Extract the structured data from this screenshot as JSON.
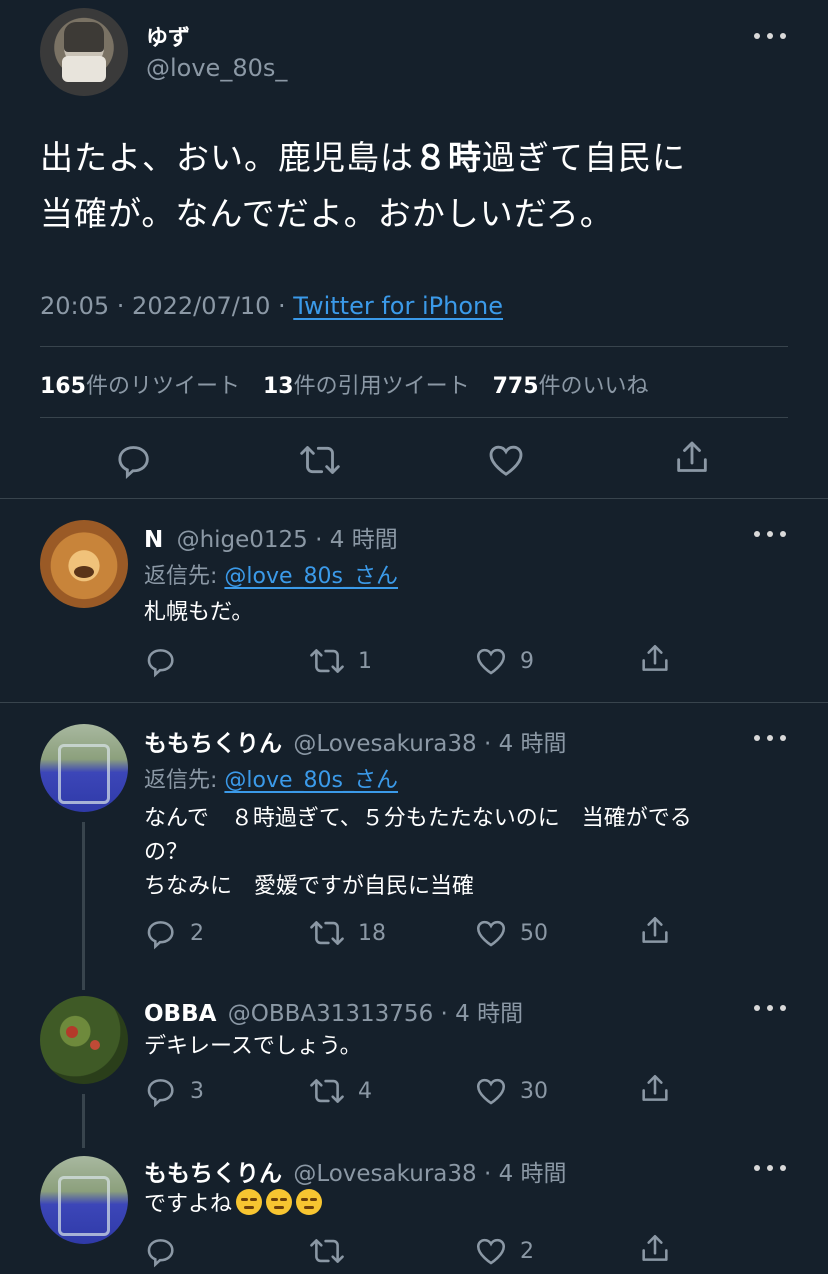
{
  "main": {
    "display_name": "ゆず",
    "handle": "@love_80s_",
    "text_line1_a": "出たよ、おい。鹿児島は",
    "text_line1_b": "８時",
    "text_line1_c": "過ぎて自民に",
    "text_line2": "当確が。なんでだよ。おかしいだろ。",
    "time": "20:05 · 2022/07/10 ·",
    "source": "Twitter for iPhone",
    "retweets_count": "165",
    "retweets_label": "件のリツイート",
    "quotes_count": "13",
    "quotes_label": "件の引用ツイート",
    "likes_count": "775",
    "likes_label": "件のいいね"
  },
  "replies": [
    {
      "name": "N",
      "handle": "@hige0125 · 4 時間",
      "reply_to_label": "返信先:",
      "reply_to": "@love_80s_さん",
      "lines": [
        "札幌もだ。"
      ],
      "replies": "",
      "retweets": "1",
      "likes": "9"
    },
    {
      "name": "ももちくりん",
      "handle": "@Lovesakura38 · 4 時間",
      "reply_to_label": "返信先:",
      "reply_to": "@love_80s_さん",
      "lines": [
        "なんで　８時過ぎて、５分もたたないのに　当確がでる",
        "の？",
        "ちなみに　愛媛ですが自民に当確"
      ],
      "replies": "2",
      "retweets": "18",
      "likes": "50"
    },
    {
      "name": "OBBA",
      "handle": "@OBBA31313756 · 4 時間",
      "lines": [
        "デキレースでしょう。"
      ],
      "replies": "3",
      "retweets": "4",
      "likes": "30"
    },
    {
      "name": "ももちくりん",
      "handle": "@Lovesakura38 · 4 時間",
      "lines": [
        "ですよね"
      ],
      "replies": "",
      "retweets": "",
      "likes": "2"
    }
  ]
}
